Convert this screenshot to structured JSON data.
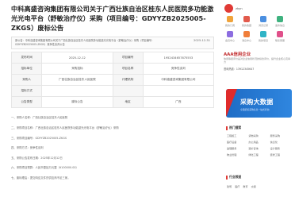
{
  "article": {
    "title": "中科高盛咨询集团有限公司关于广西壮族自治区桂东人民医院多功能激光光电平台（舒敏治疗仪）采购（项目编号：GDYYZB2025005-ZKGS）废标公告",
    "notice_text": "原公告：中科高盛咨询集团有限公司关于广西壮族自治区桂东人民医院多功能激光光电平台（舒敏治疗仪）采购（项目编号：GDYYZB2025005-ZKGS）竞争性谈判公告",
    "notice_date": "2025-12-31",
    "meta": [
      {
        "k1": "发布时间",
        "v1": "2025-12-12",
        "k2": "项目编号",
        "v2": "1952434657875553"
      },
      {
        "k1": "招标单位",
        "v1": "采购招标",
        "k2": "项目名称",
        "v2": "竞争性谈判"
      },
      {
        "k1": "采购人",
        "v1": "广西壮族自治区桂东人民医院",
        "k2": "代理机构",
        "v2": "中科高盛咨询集团有限公司"
      },
      {
        "k1": "招标方式",
        "v1": "",
        "k2": "",
        "v2": ""
      },
      {
        "k1": "公告类型",
        "v1": "废标公告",
        "k2": "地区",
        "v2": "广西"
      }
    ],
    "body_lines": [
      "一、采购人名称：广西壮族自治区桂东人民医院",
      "二、采购项目名称：广西壮族自治区桂东人民医院多功能激光光电平台（舒敏治疗仪）采购",
      "三、采购项目编号：GDYYZB2025005-ZKGS",
      "四、采购方式：竞争性谈判",
      "五、采购公告发布日期：2025年12月12日",
      "六、采购项目预算：人民币壹拾万元整（¥100000.00）",
      "七、废标理由：提交响应文件的供应商不足三家。"
    ]
  },
  "sidebar": {
    "user_name": "zkyn",
    "quick_links": [
      "我的订阅",
      "我的收藏",
      "浏览记录",
      "发布信息",
      "会员中心",
      "消息中心",
      "我的项目",
      "联系客服"
    ],
    "aaa": {
      "badge": "AAA",
      "title": "AAA信用企业",
      "desc": "信用等级评价是对企业信用状况的综合评价，提升企业核心竞争力",
      "phone": "咨询热线：13912345647"
    },
    "banner": {
      "title": "采购大数据",
      "subtitle": "全国招标采购信息一站式查询"
    },
    "hot_title": "热门搜索",
    "hot_items": [
      "工程施工",
      "货物采购",
      "服务采购",
      "医疗设备",
      "办公用品",
      "信息化",
      "监理服务",
      "造价咨询",
      "设计服务",
      "物业管理",
      "绿化工程",
      "装修工程"
    ],
    "industry_title": "行业频道",
    "industry_items": [
      "建筑",
      "医疗",
      "教育",
      "交通"
    ]
  }
}
